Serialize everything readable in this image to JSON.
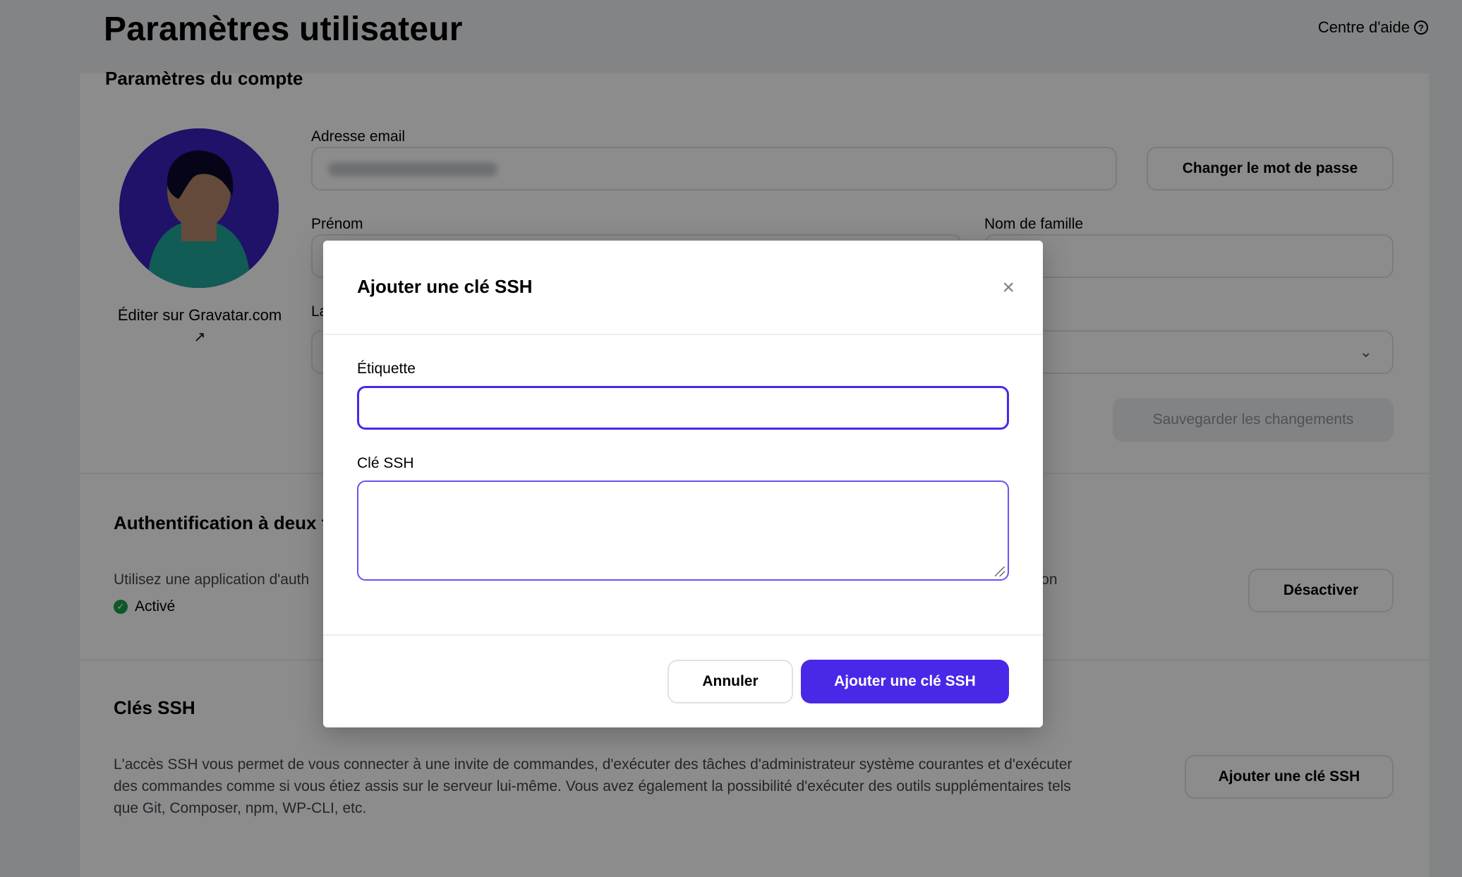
{
  "header": {
    "title": "Paramètres utilisateur",
    "help_label": "Centre d'aide",
    "help_icon": "?"
  },
  "account": {
    "section_title": "Paramètres du compte",
    "gravatar_link": "Éditer sur Gravatar.com",
    "email_label": "Adresse email",
    "change_password": "Changer le mot de passe",
    "first_name_label": "Prénom",
    "last_name_label": "Nom de famille",
    "language_label_partial": "La",
    "save_changes": "Sauvegarder les changements"
  },
  "two_factor": {
    "section_title_partial": "Authentification à deux fa",
    "description_left": "Utilisez une application d'auth",
    "description_right": "ation",
    "status": "Activé",
    "disable_button": "Désactiver"
  },
  "ssh": {
    "section_title": "Clés SSH",
    "description": "L'accès SSH vous permet de vous connecter à une invite de commandes, d'exécuter des tâches d'administrateur système courantes et d'exécuter des commandes comme si vous étiez assis sur le serveur lui-même. Vous avez également la possibilité d'exécuter des outils supplémentaires tels que Git, Composer, npm, WP-CLI, etc.",
    "add_button": "Ajouter une clé SSH"
  },
  "modal": {
    "title": "Ajouter une clé SSH",
    "close_icon": "×",
    "label_field": "Étiquette",
    "label_value": "",
    "key_field": "Clé SSH",
    "key_value": "",
    "cancel": "Annuler",
    "submit": "Ajouter une clé SSH"
  },
  "colors": {
    "accent": "#4b27e8",
    "overlay": "rgba(0,0,0,0.45)",
    "success": "#1b9e4b"
  }
}
